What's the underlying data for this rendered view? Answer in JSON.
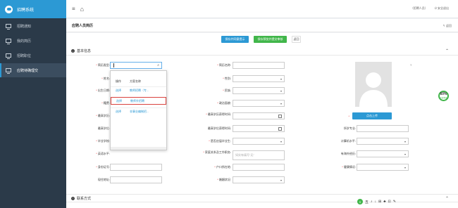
{
  "app": {
    "title": "招聘系统"
  },
  "sidebar": {
    "items": [
      {
        "label": "招聘通知"
      },
      {
        "label": "我的简历"
      },
      {
        "label": "招聘职位"
      },
      {
        "label": "应聘待确理交"
      }
    ]
  },
  "topbar": {
    "user": "（招聘人员）",
    "logout": "安全退出"
  },
  "page": {
    "title": "应聘人员简历",
    "back": "返回"
  },
  "actions": {
    "save_label": "保存并同意提示",
    "submit_label": "保存预览并提交审核",
    "cancel_label": "返回"
  },
  "section1": {
    "title": "基本信息"
  },
  "section2": {
    "title": "联系方式"
  },
  "form": {
    "type_label": "简历类型:",
    "name_label": "姓名:",
    "birth_label": "出生日期:",
    "native_label": "籍贯:",
    "edu_label": "最高学历:",
    "degree_label": "最高学位:",
    "school_label": "毕业学校:",
    "lang_label": "英语水平:",
    "id_label": "身份证号:",
    "marital_label": "现住地址:",
    "resume_name_label": "简历名称:",
    "gender_label": "性别:",
    "nation_label": "民族:",
    "politics_label": "政治面貌:",
    "grad_time_label": "最高学历获得时间:",
    "degree_time_label": "最高学位获得时间:",
    "fresh_label": "是否应届毕业生:",
    "work_label": "家庭关系及工作职务:",
    "hukou_label": "户口所在地:",
    "health_label": "婚姻状况:",
    "major_label": "所学专业:",
    "computer_label": "计算机水平:",
    "other_lang_label": "有海外经历:",
    "health2_label": "健康情况:",
    "upload_label": "点击上传",
    "work_placeholder": "如实有填写“无”"
  },
  "progress": {
    "value": "60%",
    "caption": "完善程度"
  },
  "popup": {
    "col_action": "操作",
    "col_name": "方案名称",
    "rows": [
      {
        "action": "选择",
        "name": "教师招聘（专..."
      },
      {
        "action": "选择",
        "name": "教师外招聘"
      },
      {
        "action": "选择",
        "name": "非事业编制招..."
      }
    ]
  },
  "footer_tools": [
    "S",
    "五",
    "♪",
    "↓",
    "⊞",
    "♣",
    "⊡",
    "✎"
  ]
}
